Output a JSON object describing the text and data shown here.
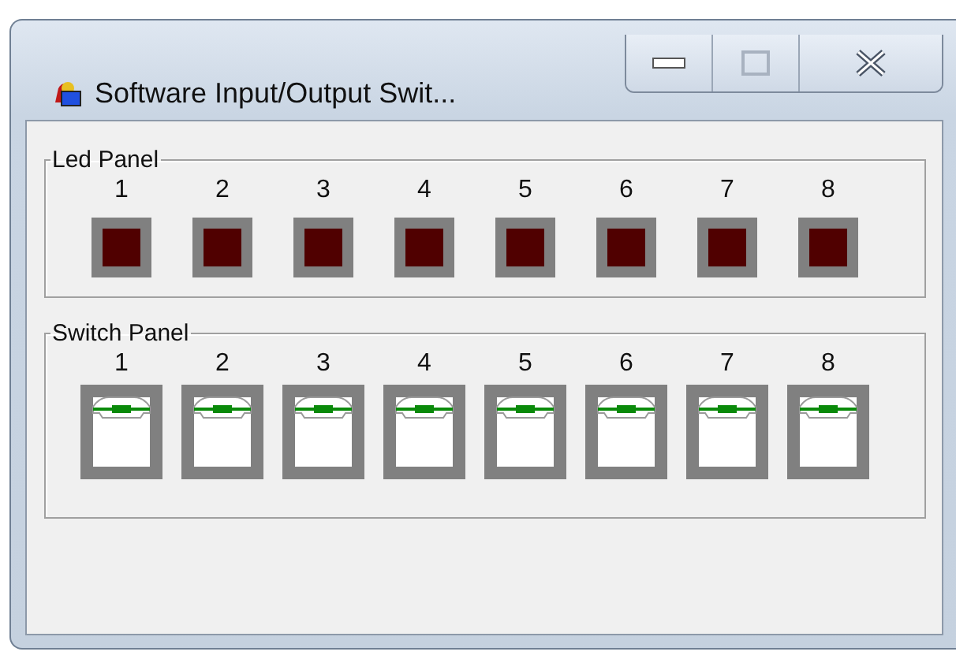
{
  "window": {
    "title": "Software Input/Output Swit..."
  },
  "led_panel": {
    "title": "Led Panel",
    "leds": [
      {
        "label": "1",
        "on": false
      },
      {
        "label": "2",
        "on": false
      },
      {
        "label": "3",
        "on": false
      },
      {
        "label": "4",
        "on": false
      },
      {
        "label": "5",
        "on": false
      },
      {
        "label": "6",
        "on": false
      },
      {
        "label": "7",
        "on": false
      },
      {
        "label": "8",
        "on": false
      }
    ]
  },
  "switch_panel": {
    "title": "Switch Panel",
    "switches": [
      {
        "label": "1",
        "on": false
      },
      {
        "label": "2",
        "on": false
      },
      {
        "label": "3",
        "on": false
      },
      {
        "label": "4",
        "on": false
      },
      {
        "label": "5",
        "on": false
      },
      {
        "label": "6",
        "on": false
      },
      {
        "label": "7",
        "on": false
      },
      {
        "label": "8",
        "on": false
      }
    ]
  }
}
